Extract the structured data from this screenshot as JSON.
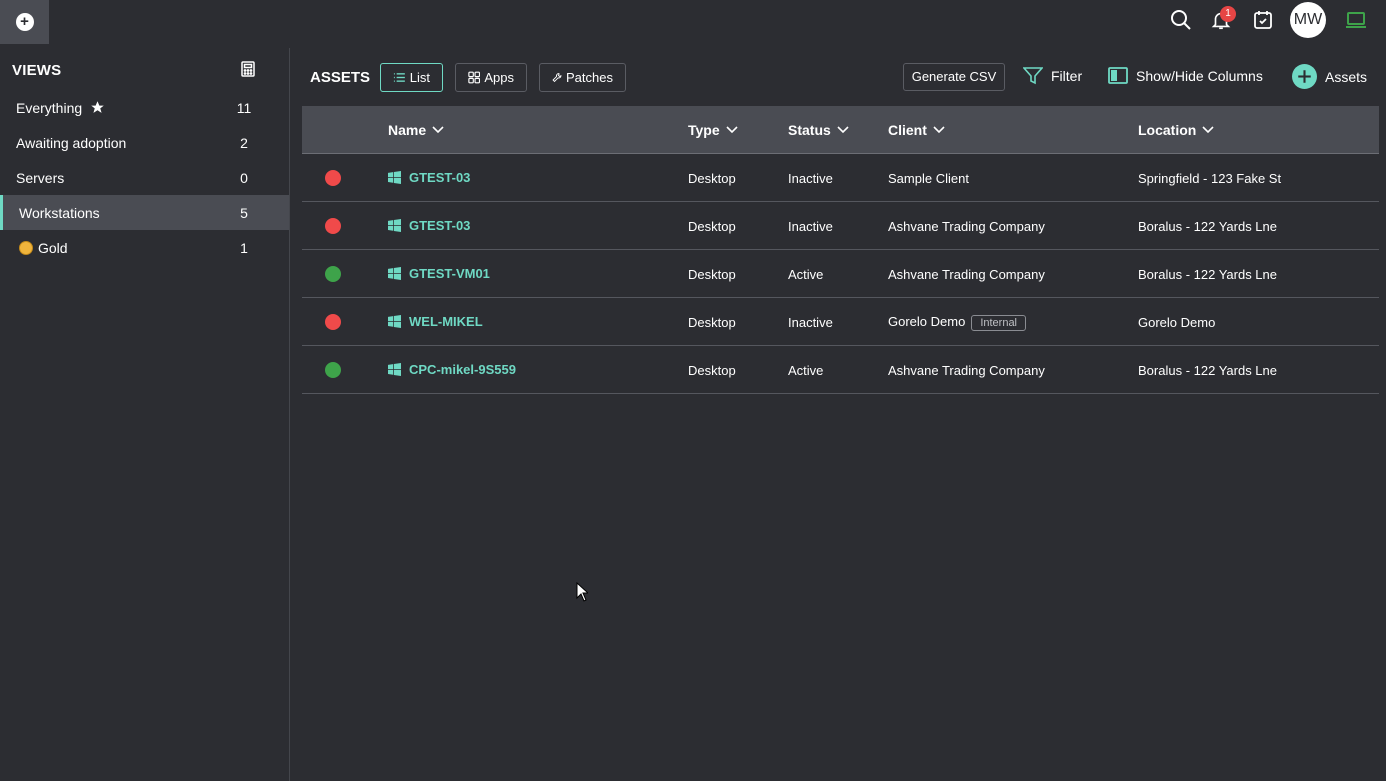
{
  "topbar": {
    "new_button_glyph": "+",
    "icons": [
      "search-icon",
      "bell-icon",
      "calendar-check-icon",
      "laptop-icon"
    ],
    "notification_count": "1",
    "avatar_initials": "MW",
    "accent": "#6fd9c4"
  },
  "sidebar": {
    "title": "VIEWS",
    "items": [
      {
        "label": "Everything",
        "count": "11",
        "starred": true
      },
      {
        "label": "Awaiting adoption",
        "count": "2"
      },
      {
        "label": "Servers",
        "count": "0"
      },
      {
        "label": "Workstations",
        "count": "5",
        "active": true
      },
      {
        "label": "Gold",
        "count": "1",
        "icon": "gold-coin-icon"
      }
    ]
  },
  "main": {
    "title": "ASSETS",
    "tabs": [
      {
        "label": "List",
        "active": true
      },
      {
        "label": "Apps"
      },
      {
        "label": "Patches"
      }
    ],
    "generate_csv": "Generate CSV",
    "filter": "Filter",
    "show_hide": "Show/Hide Columns",
    "add_assets": "Assets"
  },
  "table": {
    "columns": [
      "Name",
      "Type",
      "Status",
      "Client",
      "Location"
    ],
    "rows": [
      {
        "name": "GTEST-03",
        "type": "Desktop",
        "status": "Inactive",
        "status_color": "#f04a4a",
        "client": "Sample Client",
        "location": "Springfield - 123 Fake St"
      },
      {
        "name": "GTEST-03",
        "type": "Desktop",
        "status": "Inactive",
        "status_color": "#f04a4a",
        "client": "Ashvane Trading Company",
        "location": "Boralus - 122 Yards Lne"
      },
      {
        "name": "GTEST-VM01",
        "type": "Desktop",
        "status": "Active",
        "status_color": "#3ea34a",
        "client": "Ashvane Trading Company",
        "location": "Boralus - 122 Yards Lne"
      },
      {
        "name": "WEL-MIKEL",
        "type": "Desktop",
        "status": "Inactive",
        "status_color": "#f04a4a",
        "client": "Gorelo Demo",
        "client_tag": "Internal",
        "location": "Gorelo Demo"
      },
      {
        "name": "CPC-mikel-9S559",
        "type": "Desktop",
        "status": "Active",
        "status_color": "#3ea34a",
        "client": "Ashvane Trading Company",
        "location": "Boralus - 122 Yards Lne"
      }
    ]
  }
}
